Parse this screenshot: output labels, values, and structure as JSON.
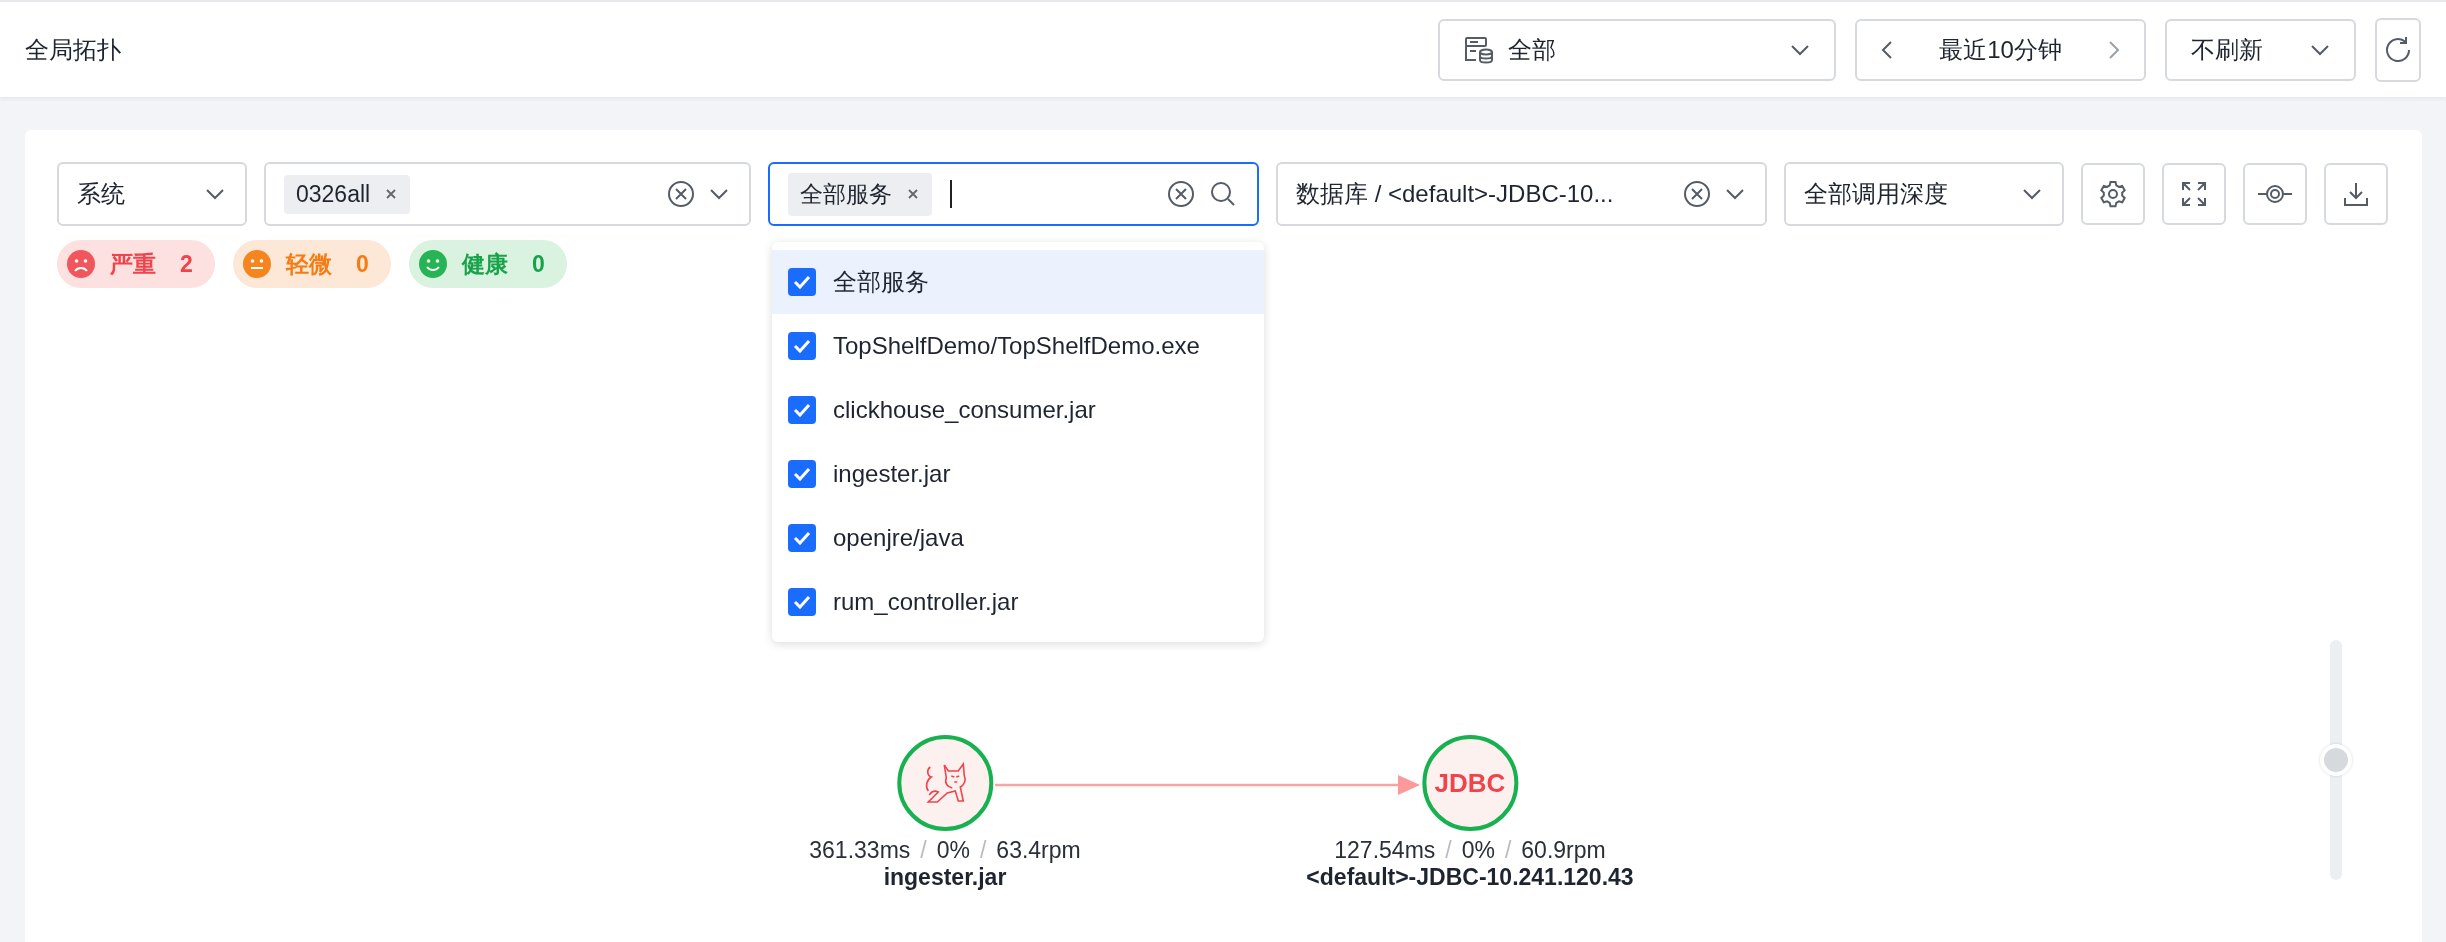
{
  "header": {
    "title": "全局拓扑",
    "scope_select": {
      "value": "全部"
    },
    "time_range": {
      "value": "最近10分钟"
    },
    "refresh_select": {
      "value": "不刷新"
    }
  },
  "filters": {
    "type_select": {
      "value": "系统"
    },
    "system_select": {
      "tags": [
        "0326all"
      ]
    },
    "service_select": {
      "tags": [
        "全部服务"
      ]
    },
    "database_select": {
      "value": "数据库 / <default>-JDBC-10..."
    },
    "depth_select": {
      "value": "全部调用深度"
    }
  },
  "health_badges": [
    {
      "kind": "critical",
      "label": "严重",
      "count": "2"
    },
    {
      "kind": "minor",
      "label": "轻微",
      "count": "0"
    },
    {
      "kind": "healthy",
      "label": "健康",
      "count": "0"
    }
  ],
  "service_dropdown": {
    "options": [
      {
        "label": "全部服务",
        "checked": true,
        "selected": true
      },
      {
        "label": "TopShelfDemo/TopShelfDemo.exe",
        "checked": true,
        "selected": false
      },
      {
        "label": "clickhouse_consumer.jar",
        "checked": true,
        "selected": false
      },
      {
        "label": "ingester.jar",
        "checked": true,
        "selected": false
      },
      {
        "label": "openjre/java",
        "checked": true,
        "selected": false
      },
      {
        "label": "rum_controller.jar",
        "checked": true,
        "selected": false
      }
    ]
  },
  "topology": {
    "nodes": [
      {
        "kind": "tomcat",
        "metrics": [
          "361.33ms",
          "0%",
          "63.4rpm"
        ],
        "separator": "/",
        "name": "ingester.jar"
      },
      {
        "kind": "jdbc",
        "icon_text": "JDBC",
        "metrics": [
          "127.54ms",
          "0%",
          "60.9rpm"
        ],
        "separator": "/",
        "name": "<default>-JDBC-10.241.120.43"
      }
    ],
    "zoom": {
      "level": 0.5
    }
  }
}
